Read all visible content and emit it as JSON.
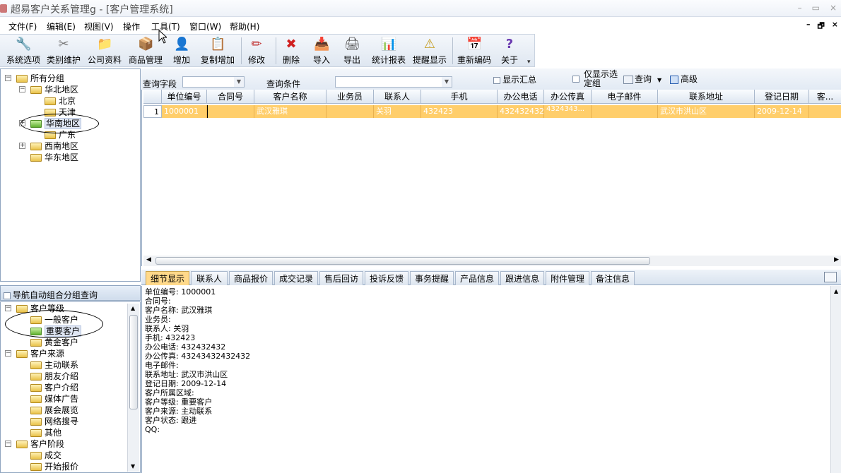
{
  "window": {
    "title": "超易客户关系管理g - [客户管理系统]",
    "min": "–",
    "max": "▭",
    "close": "×",
    "mdi_min": "–",
    "mdi_restore": "🗗",
    "mdi_close": "×"
  },
  "menu": [
    "文件(F)",
    "编辑(E)",
    "视图(V)",
    "操作",
    "工具(T)",
    "窗口(W)",
    "帮助(H)"
  ],
  "toolbar": [
    {
      "label": "系统选项",
      "icon": "wrench-icon",
      "glyph": "🔧"
    },
    {
      "label": "类别维护",
      "icon": "tools-icon",
      "glyph": "✂"
    },
    {
      "label": "公司资料",
      "icon": "folder-icon",
      "glyph": "📁"
    },
    {
      "label": "商品管理",
      "icon": "box-icon",
      "glyph": "📦"
    },
    {
      "label": "增加",
      "icon": "user-add-icon",
      "glyph": "👤"
    },
    {
      "label": "复制增加",
      "icon": "copy-add-icon",
      "glyph": "📋"
    },
    {
      "label": "修改",
      "icon": "pencil-icon",
      "glyph": "✏"
    },
    {
      "label": "删除",
      "icon": "delete-icon",
      "glyph": "✖"
    },
    {
      "label": "导入",
      "icon": "import-icon",
      "glyph": "📥"
    },
    {
      "label": "导出",
      "icon": "export-icon",
      "glyph": "🖨"
    },
    {
      "label": "统计报表",
      "icon": "chart-icon",
      "glyph": "📊"
    },
    {
      "label": "提醒显示",
      "icon": "alert-icon",
      "glyph": "⚠"
    },
    {
      "label": "重新编码",
      "icon": "calendar-icon",
      "glyph": "📅"
    },
    {
      "label": "关于",
      "icon": "help-icon",
      "glyph": "?"
    }
  ],
  "tree_groups": {
    "root": "所有分组",
    "items": [
      "华北地区",
      "北京",
      "天津",
      "华南地区",
      "广东",
      "西南地区",
      "华东地区"
    ]
  },
  "nav_toggle": "导航自动组合分组查询",
  "tree_levels": {
    "grade": "客户等级",
    "grade_items": [
      "一般客户",
      "重要客户",
      "黄金客户"
    ],
    "source": "客户来源",
    "source_items": [
      "主动联系",
      "朋友介绍",
      "客户介绍",
      "媒体广告",
      "展会展览",
      "网络搜寻",
      "其他"
    ],
    "stage": "客户阶段",
    "stage_items": [
      "成交",
      "开始报价"
    ]
  },
  "query": {
    "field_label": "查询字段",
    "cond_label": "查询条件",
    "show_summary": "显示汇总",
    "only_group_l1": "仅显示选",
    "only_group_l2": "定组",
    "search": "查询",
    "advanced": "高级"
  },
  "grid": {
    "columns": [
      "单位编号",
      "合同号",
      "客户名称",
      "业务员",
      "联系人",
      "手机",
      "办公电话",
      "办公传真",
      "电子邮件",
      "联系地址",
      "登记日期",
      "客..."
    ],
    "row": [
      "1",
      "1000001",
      "",
      "武汉雅琪",
      "",
      "关羽",
      "432423",
      "432432432",
      "4324343...",
      "",
      "武汉市洪山区",
      "2009-12-14",
      ""
    ]
  },
  "tabs": [
    "细节显示",
    "联系人",
    "商品报价",
    "成交记录",
    "售后回访",
    "投诉反馈",
    "事务提醒",
    "产品信息",
    "跟进信息",
    "附件管理",
    "备注信息"
  ],
  "detail": [
    "单位编号: 1000001",
    "合同号:",
    "客户名称: 武汉雅琪",
    "业务员:",
    "联系人: 关羽",
    "手机: 432423",
    "办公电话: 432432432",
    "办公传真: 43243432432432",
    "电子邮件:",
    "联系地址: 武汉市洪山区",
    "登记日期: 2009-12-14",
    "客户所属区域:",
    "客户等级: 重要客户",
    "客户来源: 主动联系",
    "客户状态: 跟进",
    "QQ:"
  ]
}
